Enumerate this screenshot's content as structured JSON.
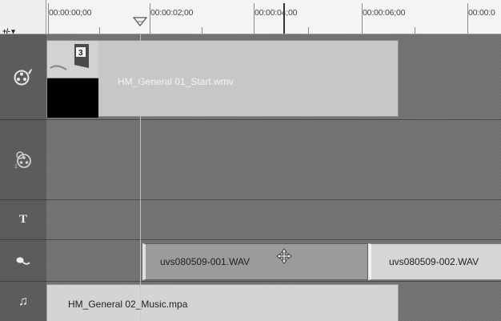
{
  "zoom_control": "+/- ▾",
  "ruler": {
    "timecodes": [
      "00:00:00;00",
      "00:00:02;00",
      "00:00:04;00",
      "00:00:06;00",
      "00:00:0"
    ]
  },
  "tracks": {
    "video": {
      "icon": "film-reel-icon",
      "clip": {
        "name": "HM_General 01_Start.wmv",
        "thumbnail_number": "3"
      }
    },
    "overlay": {
      "icon": "overlay-reel-icon"
    },
    "title": {
      "icon": "title-icon",
      "glyph": "T"
    },
    "voice": {
      "icon": "microphone-icon",
      "clips": [
        {
          "name": "uvs080509-001.WAV"
        },
        {
          "name": "uvs080509-002.WAV"
        }
      ]
    },
    "music": {
      "icon": "music-note-icon",
      "glyph": "♫",
      "clip": {
        "name": "HM_General 02_Music.mpa"
      }
    }
  }
}
